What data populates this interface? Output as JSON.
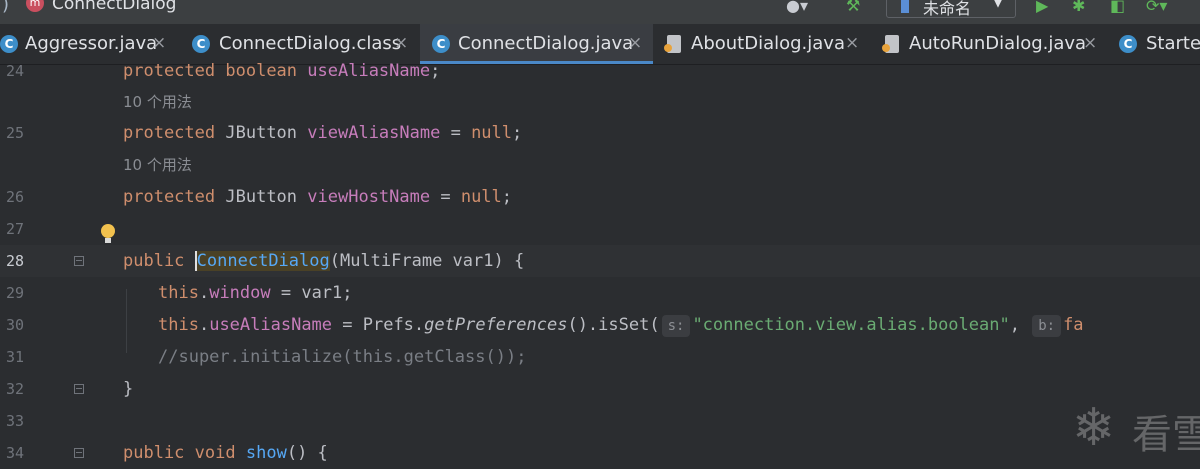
{
  "breadcrumb": {
    "separator": ")",
    "badge": "m",
    "current": "ConnectDialog"
  },
  "toolbar": {
    "run_config_label": "未命名",
    "run_config_arrow": "▼",
    "icons": [
      "user-icon",
      "build-hammer-icon",
      "run-icon",
      "debug-icon",
      "coverage-icon",
      "profile-icon"
    ]
  },
  "tabs": [
    {
      "label": "Aggressor.java",
      "icon": "C",
      "active": false
    },
    {
      "label": "ConnectDialog.class",
      "icon": "C",
      "active": false
    },
    {
      "label": "ConnectDialog.java",
      "icon": "C",
      "active": true
    },
    {
      "label": "AboutDialog.java",
      "icon": "",
      "active": false
    },
    {
      "label": "AutoRunDialog.java",
      "icon": "",
      "active": false
    },
    {
      "label": "Starter",
      "icon": "C",
      "active": false
    }
  ],
  "tab_close_glyph": "×",
  "editor": {
    "line_numbers": [
      "24",
      "25",
      "26",
      "27",
      "28",
      "29",
      "30",
      "31",
      "32",
      "33",
      "34"
    ],
    "usage_hint": "10 个用法",
    "line24": {
      "kw": "protected",
      "type": "boolean",
      "field": "useAliasName",
      "rest": ";"
    },
    "line25": {
      "kw": "protected",
      "type": "JButton",
      "field": "viewAliasName",
      "op": " = ",
      "val": "null",
      "rest": ";"
    },
    "line26": {
      "kw": "protected",
      "type": "JButton",
      "field": "viewHostName",
      "op": " = ",
      "val": "null",
      "rest": ";"
    },
    "line28": {
      "kw": "public",
      "name": "ConnectDialog",
      "rest": "(MultiFrame var1) {"
    },
    "line29": {
      "kw": "this",
      "dot": ".",
      "field": "window",
      "rest": " = var1;"
    },
    "line30": {
      "kw": "this",
      "dot": ".",
      "field": "useAliasName",
      "mid": " = Prefs.",
      "method": "getPreferences",
      "rest": "().isSet(",
      "hint1": "s:",
      "str": "\"connection.view.alias.boolean\"",
      "comma": ", ",
      "hint2": "b:",
      "tail": "fa"
    },
    "line31": {
      "comment": "//super.initialize(this.getClass());"
    },
    "line32": {
      "text": "}"
    },
    "line34": {
      "kw": "public",
      "type": "void",
      "name": "show",
      "rest": "() {"
    }
  },
  "watermark": {
    "glyph": "❄",
    "text": "看雪"
  }
}
